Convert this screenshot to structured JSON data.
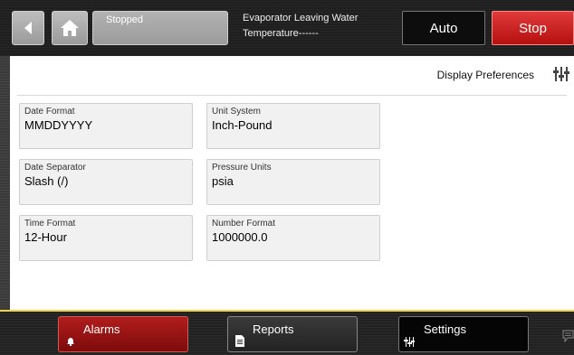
{
  "header": {
    "status": "Stopped",
    "eval_line1": "Evaporator Leaving Water",
    "eval_line2": "Temperature------",
    "auto_label": "Auto",
    "stop_label": "Stop"
  },
  "page": {
    "title": "Display Preferences"
  },
  "fields": [
    {
      "label": "Date Format",
      "value": "MMDDYYYY"
    },
    {
      "label": "Unit System",
      "value": "Inch-Pound"
    },
    {
      "label": "Date Separator",
      "value": "Slash (/)"
    },
    {
      "label": "Pressure Units",
      "value": "psia"
    },
    {
      "label": "Time Format",
      "value": "12-Hour"
    },
    {
      "label": "Number Format",
      "value": "1000000.0"
    }
  ],
  "nav": {
    "alarms_label": "Alarms",
    "reports_label": "Reports",
    "settings_label": "Settings"
  },
  "colors": {
    "stop_red": "#c41a1a",
    "alarms_red": "#9e1414",
    "accent_yellow": "#f3d13c"
  },
  "icons": {
    "back": "left-arrow-icon",
    "home": "home-icon",
    "preferences": "sliders-icon",
    "alarm": "bell-icon",
    "reports": "document-icon",
    "settings": "sliders-icon",
    "chat": "chat-icon"
  }
}
